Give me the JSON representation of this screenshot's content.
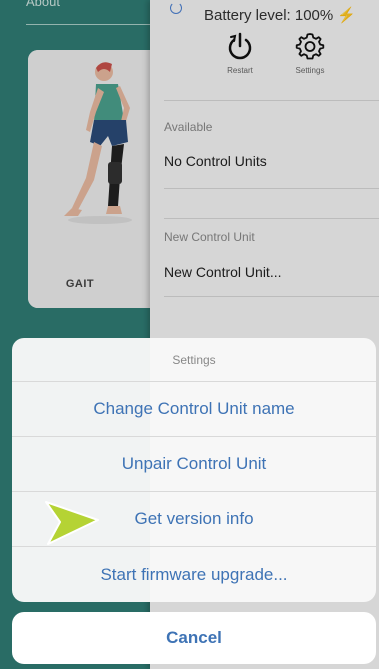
{
  "background": {
    "top_label": "About",
    "gait_card_label": "GAIT"
  },
  "panel": {
    "battery_text": "Battery level: 100%",
    "battery_icon": "⚡",
    "actions": [
      {
        "label": "Restart",
        "icon": "restart-icon"
      },
      {
        "label": "Settings",
        "icon": "gear-icon"
      }
    ],
    "available_header": "Available",
    "available_value": "No Control Units",
    "new_header": "New Control Unit",
    "new_value": "New Control Unit..."
  },
  "sheet": {
    "title": "Settings",
    "options": [
      "Change Control Unit name",
      "Unpair Control Unit",
      "Get version info",
      "Start firmware upgrade..."
    ],
    "cancel": "Cancel"
  },
  "colors": {
    "accent": "#3e73b5",
    "teal": "#2f7c74",
    "pointer": "#b5d334"
  }
}
